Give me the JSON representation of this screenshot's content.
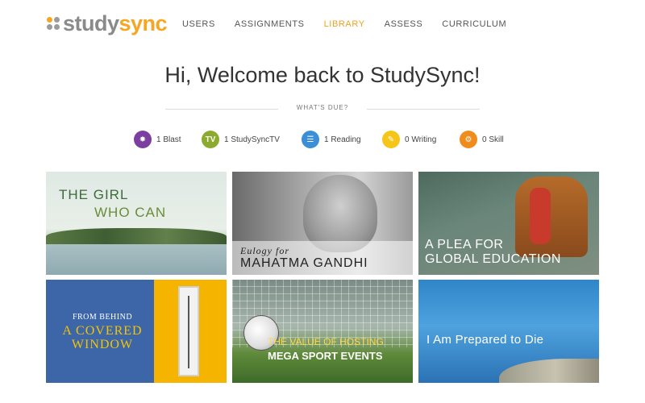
{
  "brand": {
    "study": "study",
    "sync": "sync",
    "dot_colors": [
      "#f5a623",
      "#9b9b9b",
      "#9b9b9b",
      "#9b9b9b"
    ]
  },
  "nav": {
    "items": [
      {
        "label": "USERS",
        "active": false
      },
      {
        "label": "ASSIGNMENTS",
        "active": false
      },
      {
        "label": "LIBRARY",
        "active": true
      },
      {
        "label": "ASSESS",
        "active": false
      },
      {
        "label": "CURRICULUM",
        "active": false
      }
    ]
  },
  "welcome": {
    "title": "Hi, Welcome back to StudySync!",
    "due_label": "WHAT'S DUE?"
  },
  "due": [
    {
      "label": "1 Blast",
      "icon": "blast-icon",
      "glyph": "✸",
      "color": "#7b3fa0"
    },
    {
      "label": "1 StudySyncTV",
      "icon": "tv-icon",
      "glyph": "TV",
      "color": "#8cab2e"
    },
    {
      "label": "1 Reading",
      "icon": "reading-icon",
      "glyph": "☰",
      "color": "#3a8fd6"
    },
    {
      "label": "0 Writing",
      "icon": "writing-icon",
      "glyph": "✎",
      "color": "#f5c518"
    },
    {
      "label": "0 Skill",
      "icon": "skill-icon",
      "glyph": "⚙",
      "color": "#f08c1c"
    }
  ],
  "tiles": {
    "t1": {
      "line1": "THE GIRL",
      "line2": "WHO CAN"
    },
    "t2": {
      "prefix": "Eulogy for",
      "main": "MAHATMA GANDHI"
    },
    "t3": {
      "line1": "A PLEA FOR",
      "line2": "GLOBAL EDUCATION"
    },
    "t4": {
      "line1": "FROM BEHIND",
      "line2": "A COVERED",
      "line3": "WINDOW"
    },
    "t5": {
      "line1": "THE VALUE OF HOSTING",
      "line2": "MEGA SPORT EVENTS"
    },
    "t6": {
      "line1": "I Am Prepared to Die"
    }
  }
}
